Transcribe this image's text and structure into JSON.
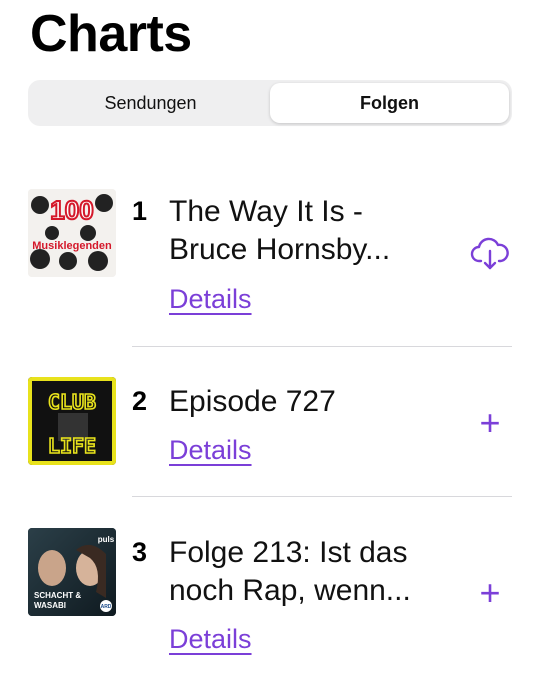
{
  "page": {
    "title": "Charts"
  },
  "segments": [
    {
      "label": "Sendungen",
      "selected": false
    },
    {
      "label": "Folgen",
      "selected": true
    }
  ],
  "episodes": [
    {
      "rank": "1",
      "title": "The Way It Is -\nBruce Hornsby...",
      "details_label": "Details",
      "action_icon": "cloud-download-icon",
      "art_text": "100 Musiklegenden"
    },
    {
      "rank": "2",
      "title": "Episode 727",
      "details_label": "Details",
      "action_icon": "plus-icon",
      "art_text": "CLUB LIFE"
    },
    {
      "rank": "3",
      "title": "Folge 213: Ist das\nnoch Rap, wenn...",
      "details_label": "Details",
      "action_icon": "plus-icon",
      "art_text": "SCHACHT & WASABI",
      "art_badge": "puls",
      "art_badge2": "ARD"
    }
  ],
  "colors": {
    "accent": "#7b3fd8",
    "divider": "#d8d8dc",
    "segment_bg": "#efeff0"
  },
  "glyphs": {
    "plus": "+"
  }
}
